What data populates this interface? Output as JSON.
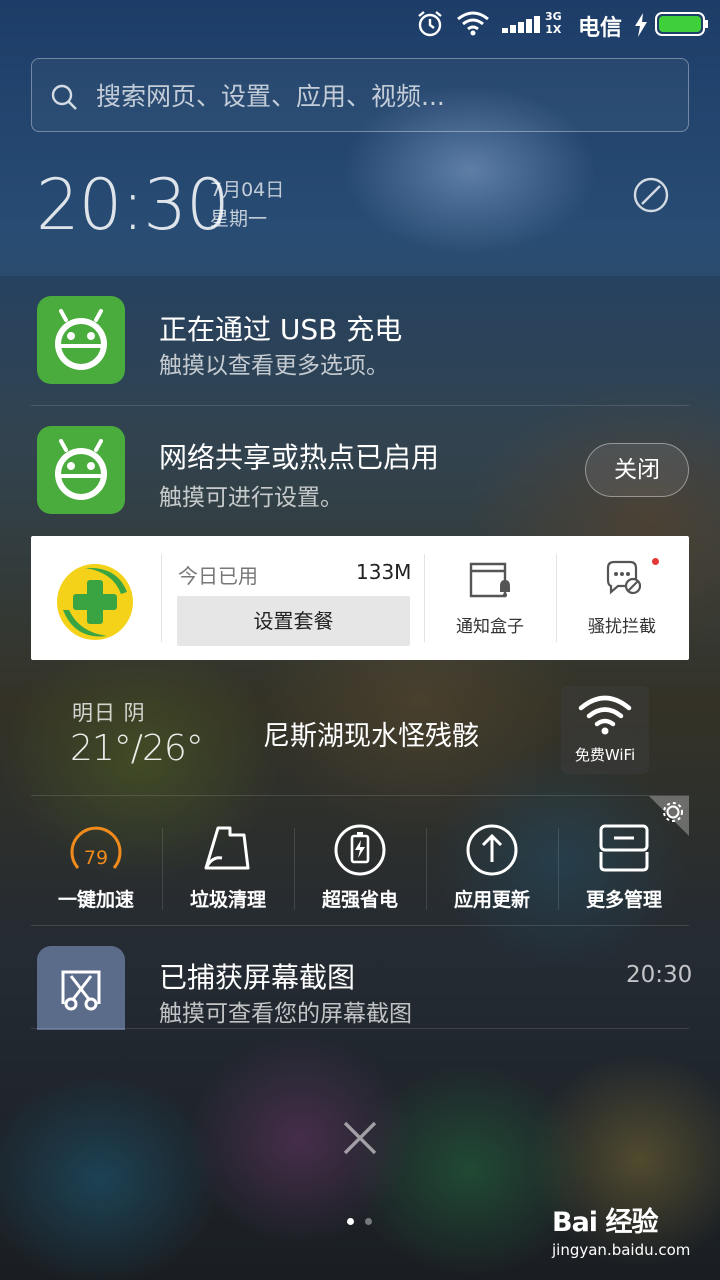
{
  "status_bar": {
    "carrier": "电信",
    "network_top": "3G",
    "network_bottom": "1X",
    "icons": [
      "alarm-icon",
      "wifi-icon",
      "signal-icon",
      "charging-icon",
      "battery-icon"
    ],
    "battery_level_percent": 100,
    "battery_color": "#3ecf3a"
  },
  "search": {
    "placeholder": "搜索网页、设置、应用、视频..."
  },
  "clock": {
    "time": "20:30",
    "date": "7月04日",
    "weekday": "星期一"
  },
  "notifications": [
    {
      "title": "正在通过 USB 充电",
      "subtitle": "触摸以查看更多选项。",
      "icon": "android-icon"
    },
    {
      "title": "网络共享或热点已启用",
      "subtitle": "触摸可进行设置。",
      "icon": "android-icon",
      "action_label": "关闭"
    }
  ],
  "security_card": {
    "used_label": "今日已用",
    "used_value": "133M",
    "plan_button": "设置套餐",
    "actions": [
      {
        "label": "通知盒子",
        "icon": "notification-box-icon"
      },
      {
        "label": "骚扰拦截",
        "icon": "harassment-block-icon"
      }
    ],
    "accent_color": "#f4d21a"
  },
  "weather": {
    "label": "明日 阴",
    "temperature": "21°/26°",
    "headline": "尼斯湖现水怪残骸",
    "wifi_label": "免费WiFi"
  },
  "tools": [
    {
      "label": "一键加速",
      "icon": "speed-score-icon",
      "score": "79"
    },
    {
      "label": "垃圾清理",
      "icon": "trash-clean-icon"
    },
    {
      "label": "超强省电",
      "icon": "battery-save-icon"
    },
    {
      "label": "应用更新",
      "icon": "app-update-icon"
    },
    {
      "label": "更多管理",
      "icon": "more-manage-icon"
    }
  ],
  "screenshot_notification": {
    "title": "已捕获屏幕截图",
    "subtitle": "触摸可查看您的屏幕截图",
    "time": "20:30"
  },
  "watermark": {
    "logo": "Bai 经验",
    "url": "jingyan.baidu.com"
  }
}
